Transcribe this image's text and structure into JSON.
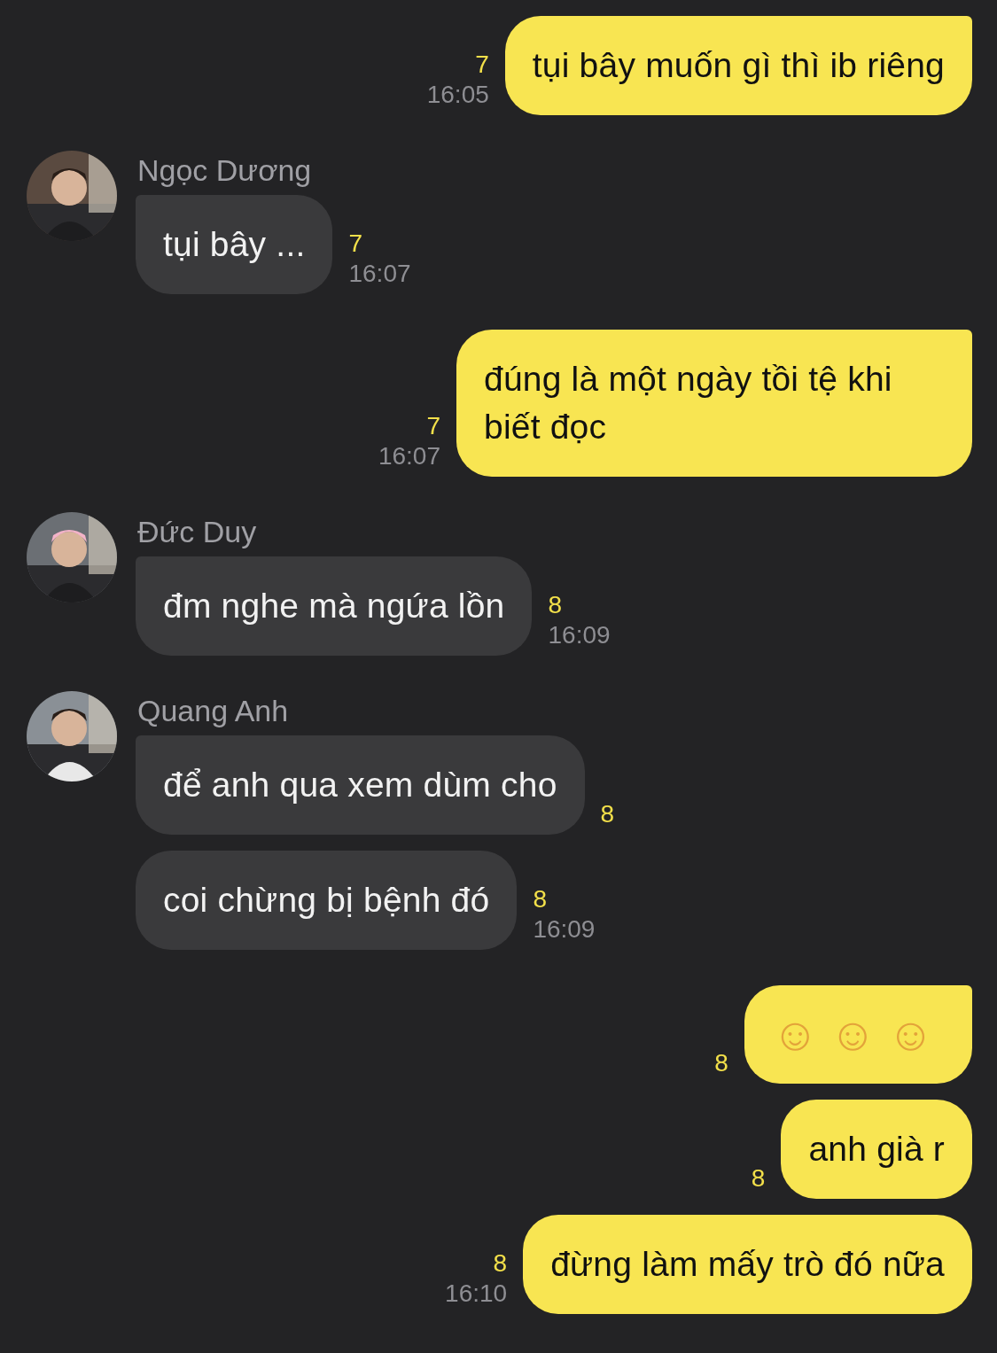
{
  "groups": [
    {
      "kind": "sent",
      "bubbles": [
        {
          "text": "tụi bây muốn gì thì ib riêng",
          "count": "7",
          "time": "16:05"
        }
      ]
    },
    {
      "kind": "received",
      "sender": "Ngọc Dương",
      "bubbles": [
        {
          "text": "tụi bây ...",
          "count": "7",
          "time": "16:07"
        }
      ]
    },
    {
      "kind": "sent",
      "bubbles": [
        {
          "text": "đúng là một ngày tồi tệ khi biết đọc",
          "count": "7",
          "time": "16:07"
        }
      ]
    },
    {
      "kind": "received",
      "sender": "Đức Duy",
      "bubbles": [
        {
          "text": "đm nghe mà ngứa lồn",
          "count": "8",
          "time": "16:09"
        }
      ]
    },
    {
      "kind": "received",
      "sender": "Quang Anh",
      "bubbles": [
        {
          "text": "để anh qua xem dùm cho",
          "count": "8"
        },
        {
          "text": "coi chừng bị bệnh đó",
          "count": "8",
          "time": "16:09"
        }
      ]
    },
    {
      "kind": "sent",
      "bubbles": [
        {
          "text": "☺☺☺",
          "count": "8",
          "emoji": true
        },
        {
          "text": "anh già r",
          "count": "8"
        },
        {
          "text": "đừng làm mấy trò đó nữa",
          "count": "8",
          "time": "16:10"
        }
      ]
    }
  ]
}
